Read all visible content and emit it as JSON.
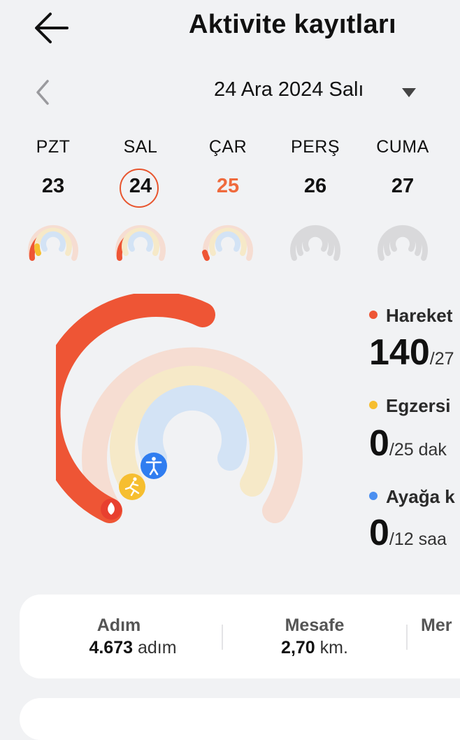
{
  "header": {
    "title": "Aktivite kayıtları"
  },
  "date_selector": {
    "label": "24 Ara 2024 Salı"
  },
  "week": [
    {
      "name": "PZT",
      "number": "23"
    },
    {
      "name": "SAL",
      "number": "24"
    },
    {
      "name": "ÇAR",
      "number": "25"
    },
    {
      "name": "PERŞ",
      "number": "26"
    },
    {
      "name": "CUMA",
      "number": "27"
    }
  ],
  "stats": {
    "move": {
      "label": "Hareket",
      "value": "140",
      "goal_text": "/27",
      "color": "#ee5535"
    },
    "exercise": {
      "label": "Egzersi",
      "value": "0",
      "goal_text": "/25 dak",
      "color": "#f6be2f"
    },
    "stand": {
      "label": "Ayağa k",
      "value": "0",
      "goal_text": "/12 saa",
      "color": "#4b8ff0"
    }
  },
  "summary": {
    "steps": {
      "label": "Adım",
      "value": "4.673",
      "unit": "adım"
    },
    "distance": {
      "label": "Mesafe",
      "value": "2,70",
      "unit": "km."
    },
    "third": {
      "label": "Mer"
    }
  },
  "colors": {
    "move": "#ee5535",
    "move_track": "#f6ddd2",
    "exercise": "#f6be2f",
    "exercise_track": "#f6e9c8",
    "stand": "#4b8ff0",
    "stand_track": "#d3e3f5",
    "selected_day_ring": "#e8552e",
    "future_day_number": "#ef6a3d",
    "empty_ring": "#d9d9db"
  }
}
